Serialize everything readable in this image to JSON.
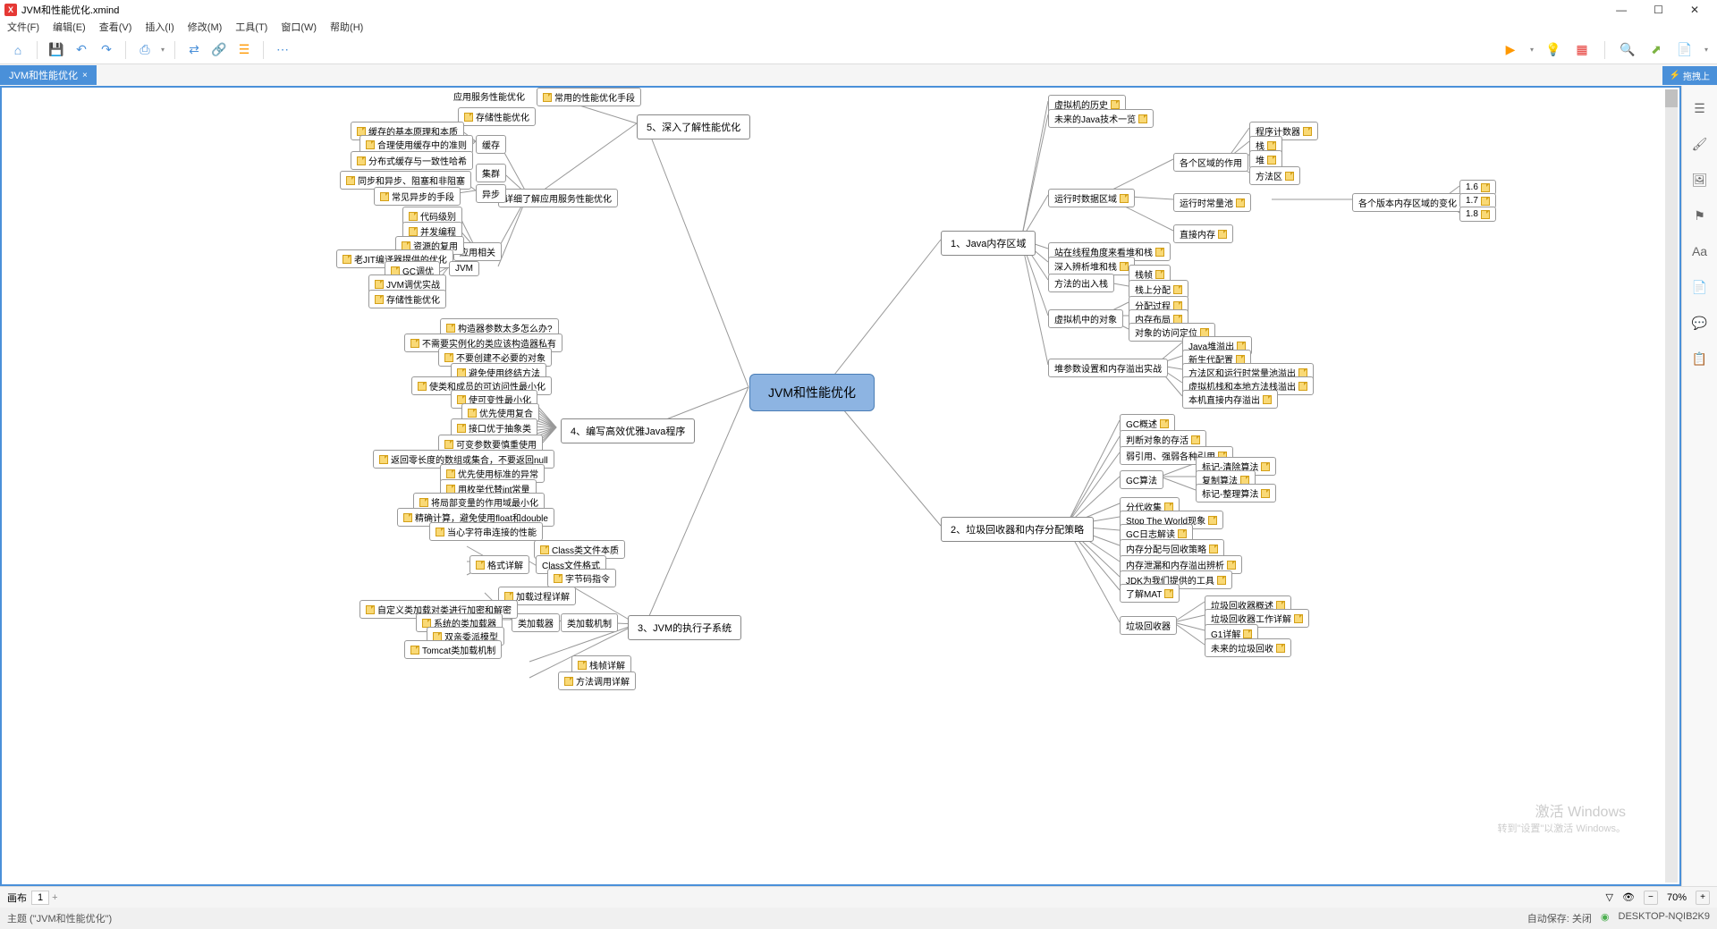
{
  "window": {
    "title": "JVM和性能优化.xmind",
    "app_icon_text": "X"
  },
  "win_controls": {
    "min": "—",
    "max": "☐",
    "close": "✕"
  },
  "menu": {
    "file": "文件(F)",
    "edit": "编辑(E)",
    "view": "查看(V)",
    "insert": "插入(I)",
    "modify": "修改(M)",
    "tools": "工具(T)",
    "window": "窗口(W)",
    "help": "帮助(H)"
  },
  "toolbar_icons": {
    "home": "⌂",
    "save": "💾",
    "undo": "↶",
    "redo": "↷",
    "export": "⎙",
    "swap": "⇄",
    "link": "🔗",
    "outline": "☰",
    "more": "⋯",
    "play": "▶",
    "idea": "💡",
    "theme": "▦",
    "search": "🔍",
    "share": "⬈",
    "new": "📄"
  },
  "tab": {
    "label": "JVM和性能优化",
    "close": "×"
  },
  "right_badge": {
    "icon": "⚡",
    "label": "拖拽上"
  },
  "central": "JVM和性能优化",
  "branch1": {
    "title": "1、Java内存区域",
    "n1": "虚拟机的历史",
    "n2": "未来的Java技术一览",
    "n3": "运行时数据区域",
    "n4": "各个区域的作用",
    "n4a": "程序计数器",
    "n4b": "栈",
    "n4c": "堆",
    "n4d": "方法区",
    "n5": "运行时常量池",
    "n5a": "各个版本内存区域的变化",
    "n5b": "1.6",
    "n5c": "1.7",
    "n5d": "1.8",
    "n6": "直接内存",
    "n7": "站在线程角度来看堆和栈",
    "n8": "深入辨析堆和栈",
    "n9": "方法的出入栈",
    "n9a": "栈帧",
    "n9b": "栈上分配",
    "n10": "虚拟机中的对象",
    "n10a": "分配过程",
    "n10b": "内存布局",
    "n10c": "对象的访问定位",
    "n11": "堆参数设置和内存溢出实战",
    "n11a": "Java堆溢出",
    "n11b": "新生代配置",
    "n11c": "方法区和运行时常量池溢出",
    "n11d": "虚拟机栈和本地方法栈溢出",
    "n11e": "本机直接内存溢出"
  },
  "branch2": {
    "title": "2、垃圾回收器和内存分配策略",
    "n1": "GC概述",
    "n2": "判断对象的存活",
    "n3": "弱引用、强弱各种引用",
    "n4": "GC算法",
    "n4a": "标记-清除算法",
    "n4b": "复制算法",
    "n4c": "标记-整理算法",
    "n5": "分代收集",
    "n6": "Stop The World现象",
    "n7": "GC日志解读",
    "n8": "内存分配与回收策略",
    "n9": "内存泄漏和内存溢出辨析",
    "n10": "JDK为我们提供的工具",
    "n11": "了解MAT",
    "n12": "垃圾回收器",
    "n12a": "垃圾回收器概述",
    "n12b": "垃圾回收器工作详解",
    "n12c": "G1详解",
    "n12d": "未来的垃圾回收"
  },
  "branch3": {
    "title": "3、JVM的执行子系统",
    "n1": "Class类文件本质",
    "n2": "Class文件格式",
    "n3": "字节码指令",
    "n4": "格式详解",
    "n5": "类加载机制",
    "n5a": "加载过程详解",
    "n5b": "类加载器",
    "n5ba": "自定义类加载对类进行加密和解密",
    "n5bb": "系统的类加载器",
    "n5bc": "双亲委派模型",
    "n5bd": "Tomcat类加载机制",
    "n6": "栈帧详解",
    "n7": "方法调用详解"
  },
  "branch4": {
    "title": "4、编写高效优雅Java程序",
    "n1": "构造器参数太多怎么办?",
    "n2": "不需要实例化的类应该构造器私有",
    "n3": "不要创建不必要的对象",
    "n4": "避免使用终结方法",
    "n5": "使类和成员的可访问性最小化",
    "n6": "使可变性最小化",
    "n7": "优先使用复合",
    "n8": "接口优于抽象类",
    "n9": "可变参数要慎重使用",
    "n10": "返回零长度的数组或集合，不要返回null",
    "n11": "优先使用标准的异常",
    "n12": "用枚举代替int常量",
    "n13": "将局部变量的作用域最小化",
    "n14": "精确计算，避免使用float和double",
    "n15": "当心字符串连接的性能"
  },
  "branch5": {
    "title": "5、深入了解性能优化",
    "n1": "常用的性能优化手段",
    "n2": "应用服务性能优化",
    "n3": "存储性能优化",
    "n4": "详细了解应用服务性能优化",
    "n5": "缓存",
    "n5a": "缓存的基本原理和本质",
    "n5b": "合理使用缓存中的准则",
    "n5c": "分布式缓存与一致性哈希",
    "n6": "集群",
    "n7": "异步",
    "n7a": "同步和异步、阻塞和非阻塞",
    "n7b": "常见异步的手段",
    "n8": "应用相关",
    "n8a": "代码级别",
    "n8b": "并发编程",
    "n8c": "资源的复用",
    "n8d": "老JIT编译器提供的优化",
    "n9": "JVM",
    "n9a": "GC调优",
    "n9b": "JVM调优实战",
    "n9c": "存储性能优化"
  },
  "sidepanel": {
    "i1": "☰",
    "i2": "🖌",
    "i3": "🖼",
    "i4": "⚑",
    "i5": "Aa",
    "i6": "📄",
    "i7": "💬",
    "i8": "📋"
  },
  "bottom": {
    "sheet_label": "画布",
    "sheet_num": "1",
    "filter": "▽",
    "eye": "👁",
    "minus": "−",
    "plus": "+",
    "zoom": "70%",
    "add_sheet": "+"
  },
  "status": {
    "topic": "主题 (\"JVM和性能优化\")",
    "autosave": "自动保存: 关闭",
    "device": "DESKTOP-NQIB2K9",
    "conn": "◉"
  },
  "watermark": {
    "l1": "激活 Windows",
    "l2": "转到\"设置\"以激活 Windows。"
  }
}
